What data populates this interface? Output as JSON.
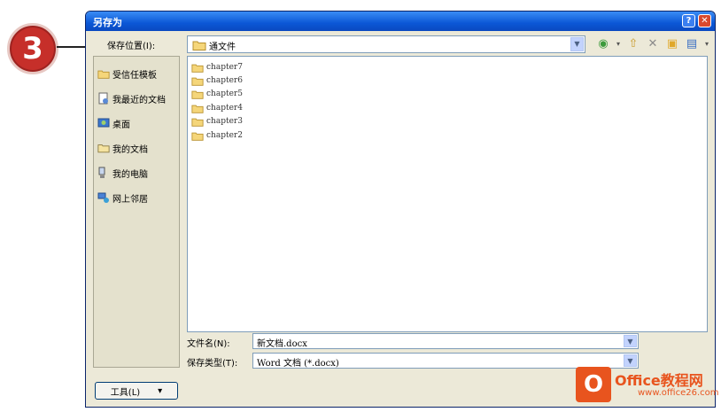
{
  "callout": {
    "number": "3"
  },
  "window": {
    "title": "另存为",
    "help_label": "?",
    "close_label": "✕"
  },
  "save_in": {
    "label": "保存位置(I):",
    "value": "通文件"
  },
  "toolbar": {
    "back_icon": "back-icon",
    "up_icon": "up-folder-icon",
    "delete_icon": "delete-icon",
    "new_folder_icon": "new-folder-icon",
    "views_icon": "views-icon"
  },
  "places": [
    {
      "label": "受信任模板",
      "icon": "folder-icon"
    },
    {
      "label": "我最近的文档",
      "icon": "recent-documents-icon"
    },
    {
      "label": "桌面",
      "icon": "desktop-icon"
    },
    {
      "label": "我的文档",
      "icon": "my-documents-icon"
    },
    {
      "label": "我的电脑",
      "icon": "my-computer-icon"
    },
    {
      "label": "网上邻居",
      "icon": "network-places-icon"
    }
  ],
  "files": [
    "chapter7",
    "chapter6",
    "chapter5",
    "chapter4",
    "chapter3",
    "chapter2"
  ],
  "file_name": {
    "label": "文件名(N):",
    "value": "新文档.docx"
  },
  "file_type": {
    "label": "保存类型(T):",
    "value": "Word 文档 (*.docx)"
  },
  "tools_button": {
    "label": "工具(L)",
    "caret": "▾"
  },
  "watermark": {
    "logo_letter": "O",
    "text": "Office教程网",
    "url": "www.office26.com"
  },
  "colors": {
    "titlebar": "#0b57d6",
    "dialog_bg": "#ece9d8",
    "callout": "#c62f2a",
    "watermark": "#e8541e"
  }
}
